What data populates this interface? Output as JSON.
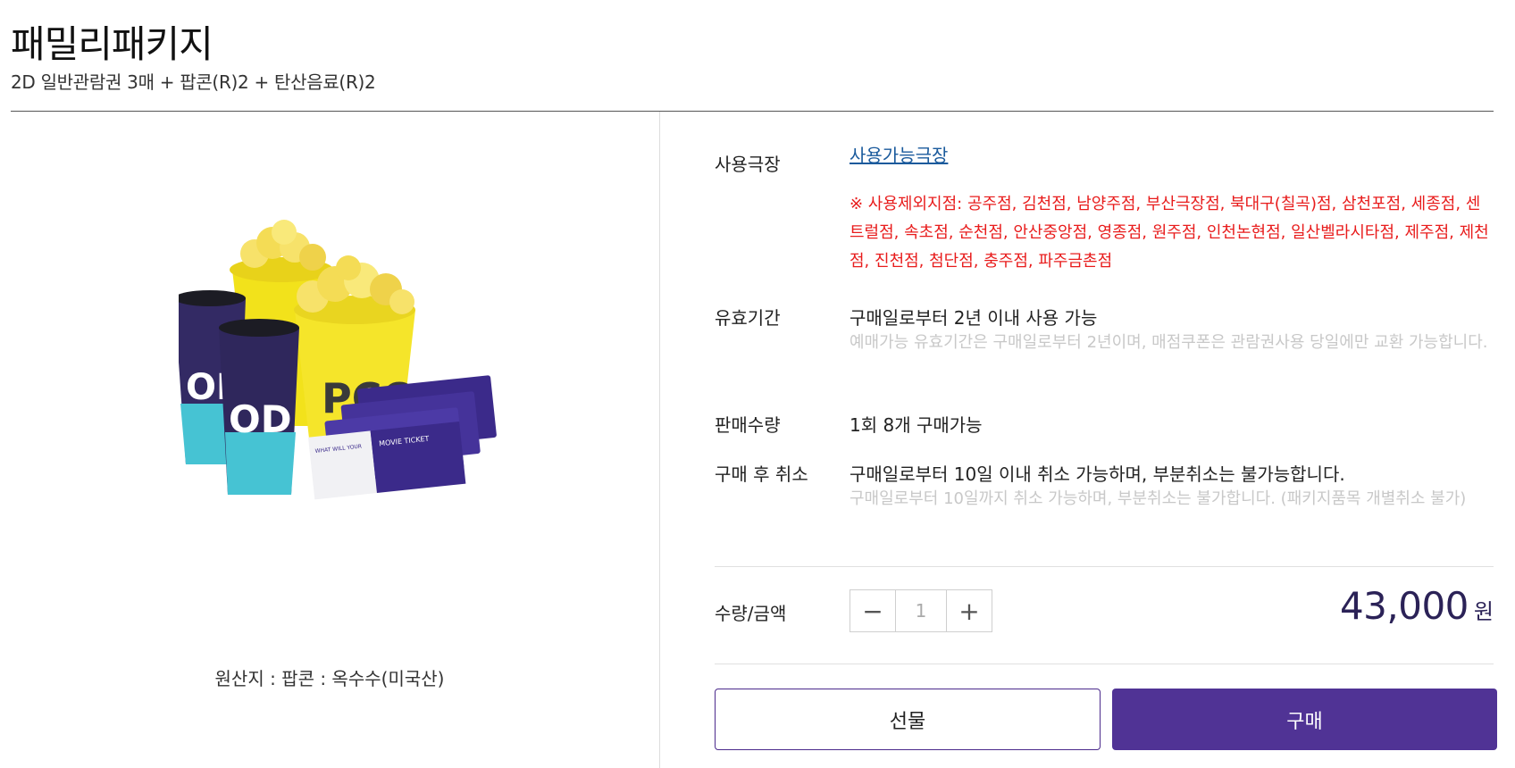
{
  "header": {
    "title": "패밀리패키지",
    "subtitle": "2D 일반관람권 3매 + 팝콘(R)2 + 탄산음료(R)2"
  },
  "left": {
    "origin": "원산지 : 팝콘 : 옥수수(미국산)"
  },
  "info": {
    "theater": {
      "label": "사용극장",
      "link": "사용가능극장",
      "exclusion": "※ 사용제외지점: 공주점, 김천점, 남양주점, 부산극장점, 북대구(칠곡)점, 삼천포점, 세종점, 센트럴점, 속초점, 순천점, 안산중앙점, 영종점, 원주점, 인천논현점, 일산벨라시타점, 제주점, 제천점, 진천점, 첨단점, 충주점, 파주금촌점"
    },
    "validity": {
      "label": "유효기간",
      "value": "구매일로부터 2년 이내 사용 가능",
      "note": "예매가능 유효기간은 구매일로부터 2년이며, 매점쿠폰은 관람권사용 당일에만 교환 가능합니다."
    },
    "sales_qty": {
      "label": "판매수량",
      "value": "1회 8개 구매가능"
    },
    "cancel": {
      "label": "구매 후 취소",
      "value": "구매일로부터 10일 이내 취소 가능하며, 부분취소는 불가능합니다.",
      "note": "구매일로부터 10일까지 취소 가능하며, 부분취소는 불가합니다. (패키지품목 개별취소 불가)"
    }
  },
  "purchase": {
    "label": "수량/금액",
    "minus": "−",
    "plus": "+",
    "quantity": "1",
    "amount": "43,000",
    "unit": "원",
    "gift_button": "선물",
    "buy_button": "구매"
  },
  "colors": {
    "accent": "#503395",
    "price": "#2b2257",
    "warning": "#e81c1c",
    "link": "#1a5a9c"
  }
}
